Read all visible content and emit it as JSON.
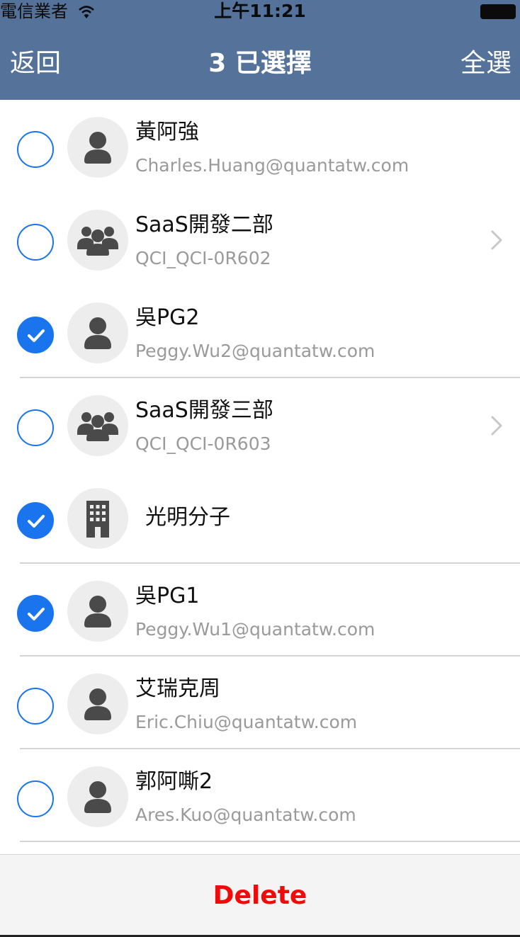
{
  "status_bar": {
    "carrier": "電信業者",
    "time": "上午11:21",
    "wifi_icon": "wifi-icon",
    "battery_icon": "battery-icon"
  },
  "nav": {
    "back_label": "返回",
    "title_count": "3",
    "title_text": "已選擇",
    "select_all_label": "全選",
    "background_color": "#55729a"
  },
  "contacts": [
    {
      "name": "黃阿強",
      "subtitle": "Charles.Huang@quantatw.com",
      "type": "person",
      "selected": false,
      "has_chevron": false
    },
    {
      "name": "SaaS開發二部",
      "subtitle": "QCI_QCI-0R602",
      "type": "group",
      "selected": false,
      "has_chevron": true
    },
    {
      "name": "吳PG2",
      "subtitle": "Peggy.Wu2@quantatw.com",
      "type": "person",
      "selected": true,
      "has_chevron": false
    },
    {
      "name": "SaaS開發三部",
      "subtitle": "QCI_QCI-0R603",
      "type": "group",
      "selected": false,
      "has_chevron": true
    },
    {
      "name": "光明分子",
      "subtitle": "",
      "type": "building",
      "selected": true,
      "has_chevron": false
    },
    {
      "name": "吳PG1",
      "subtitle": "Peggy.Wu1@quantatw.com",
      "type": "person",
      "selected": true,
      "has_chevron": false
    },
    {
      "name": "艾瑞克周",
      "subtitle": "Eric.Chiu@quantatw.com",
      "type": "person",
      "selected": false,
      "has_chevron": false
    },
    {
      "name": "郭阿嘶2",
      "subtitle": "Ares.Kuo@quantatw.com",
      "type": "person",
      "selected": false,
      "has_chevron": false
    }
  ],
  "footer": {
    "delete_label": "Delete",
    "delete_color": "#f10a0a"
  },
  "colors": {
    "accent_blue": "#1a74ee",
    "avatar_bg": "#ededed",
    "icon_dark": "#4a4a4a"
  }
}
